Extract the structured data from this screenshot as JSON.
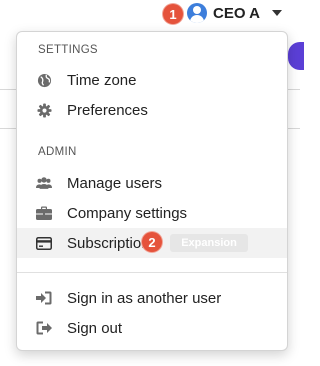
{
  "header": {
    "user_name": "CEO A",
    "step_badge": "1"
  },
  "menu": {
    "settings_label": "SETTINGS",
    "settings_items": [
      {
        "label": "Time zone",
        "icon": "globe-icon"
      },
      {
        "label": "Preferences",
        "icon": "gear-icon"
      }
    ],
    "admin_label": "ADMIN",
    "admin_items": [
      {
        "label": "Manage users",
        "icon": "users-icon"
      },
      {
        "label": "Company settings",
        "icon": "briefcase-icon"
      },
      {
        "label": "Subscription",
        "icon": "credit-card-icon"
      }
    ],
    "subscription_step_badge": "2",
    "subscription_plan_pill": "Expansion",
    "account_items": [
      {
        "label": "Sign in as another user",
        "icon": "sign-in-icon"
      },
      {
        "label": "Sign out",
        "icon": "sign-out-icon"
      }
    ]
  },
  "colors": {
    "badge": "#e5533c",
    "avatar": "#3d7edb",
    "icon_gray": "#6b6b6b",
    "highlight": "#f2f2f2"
  }
}
